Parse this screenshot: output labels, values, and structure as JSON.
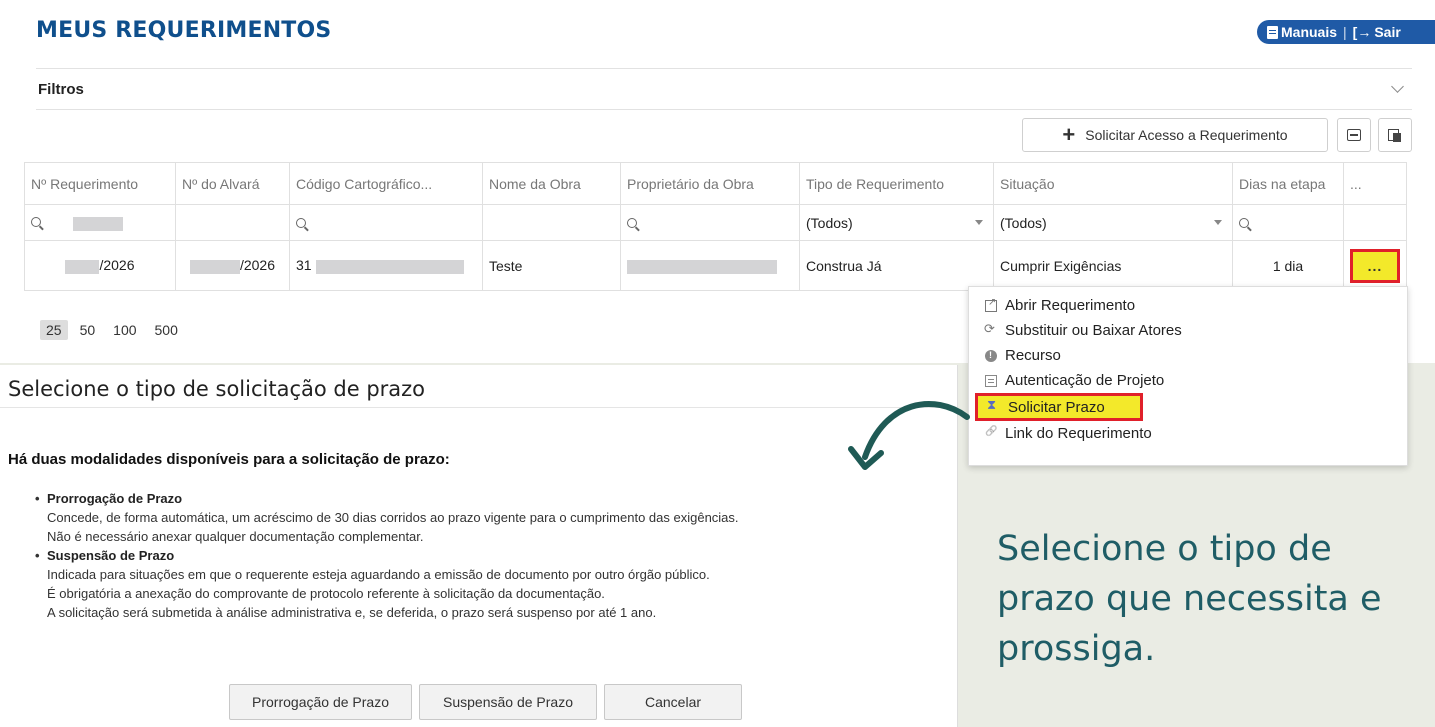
{
  "header": {
    "title": "MEUS REQUERIMENTOS",
    "manuais_label": "Manuais",
    "separator": "|",
    "sair_label": "Sair"
  },
  "filters": {
    "label": "Filtros"
  },
  "toolbar": {
    "solicitar_label": "Solicitar Acesso a Requerimento"
  },
  "table": {
    "columns": [
      "Nº Requerimento",
      "Nº do Alvará",
      "Código Cartográfico...",
      "Nome da Obra",
      "Proprietário da Obra",
      "Tipo de Requerimento",
      "Situação",
      "Dias na etapa",
      "..."
    ],
    "filter_tipo": "(Todos)",
    "filter_situacao": "(Todos)",
    "row": {
      "requerimento": "/2026",
      "alvara": "/2026",
      "codigo": "31",
      "nome_obra": "Teste",
      "tipo": "Construa Já",
      "situacao": "Cumprir Exigências",
      "dias": "1 dia",
      "actions": "..."
    }
  },
  "pager": [
    "25",
    "50",
    "100",
    "500"
  ],
  "context_menu": {
    "items": [
      {
        "label": "Abrir Requerimento",
        "icon": "external-link-icon"
      },
      {
        "label": "Substituir ou Baixar Atores",
        "icon": "refresh-icon"
      },
      {
        "label": "Recurso",
        "icon": "info-icon"
      },
      {
        "label": "Autenticação de Projeto",
        "icon": "document-icon"
      },
      {
        "label": "Solicitar Prazo",
        "icon": "hourglass-icon"
      },
      {
        "label": "Link do Requerimento",
        "icon": "link-icon"
      }
    ]
  },
  "dialog": {
    "title": "Selecione o tipo de solicitação de prazo",
    "subtitle": "Há duas modalidades disponíveis para a solicitação de prazo:",
    "option1": {
      "title": "Prorrogação de Prazo",
      "line1": "Concede, de forma automática, um acréscimo de 30 dias corridos ao prazo vigente para o cumprimento das exigências.",
      "line2": "Não é necessário anexar qualquer documentação complementar."
    },
    "option2": {
      "title": "Suspensão de Prazo",
      "line1": "Indicada para situações em que o requerente esteja aguardando a emissão de documento por outro órgão público.",
      "line2": "É obrigatória a anexação do comprovante de protocolo referente à solicitação da documentação.",
      "line3": "A solicitação será submetida à análise administrativa e, se deferida, o prazo será suspenso por até 1 ano."
    },
    "buttons": {
      "prorrogacao": "Prorrogação de Prazo",
      "suspensao": "Suspensão de Prazo",
      "cancelar": "Cancelar"
    }
  },
  "hint": "Selecione o tipo de prazo que necessita e prossiga.",
  "colors": {
    "title_blue": "#0f4f8c",
    "highlight_yellow": "#f3e92a",
    "highlight_red": "#e0202a",
    "hint_teal": "#1f5d66",
    "arrow_green": "#1f5a55"
  }
}
